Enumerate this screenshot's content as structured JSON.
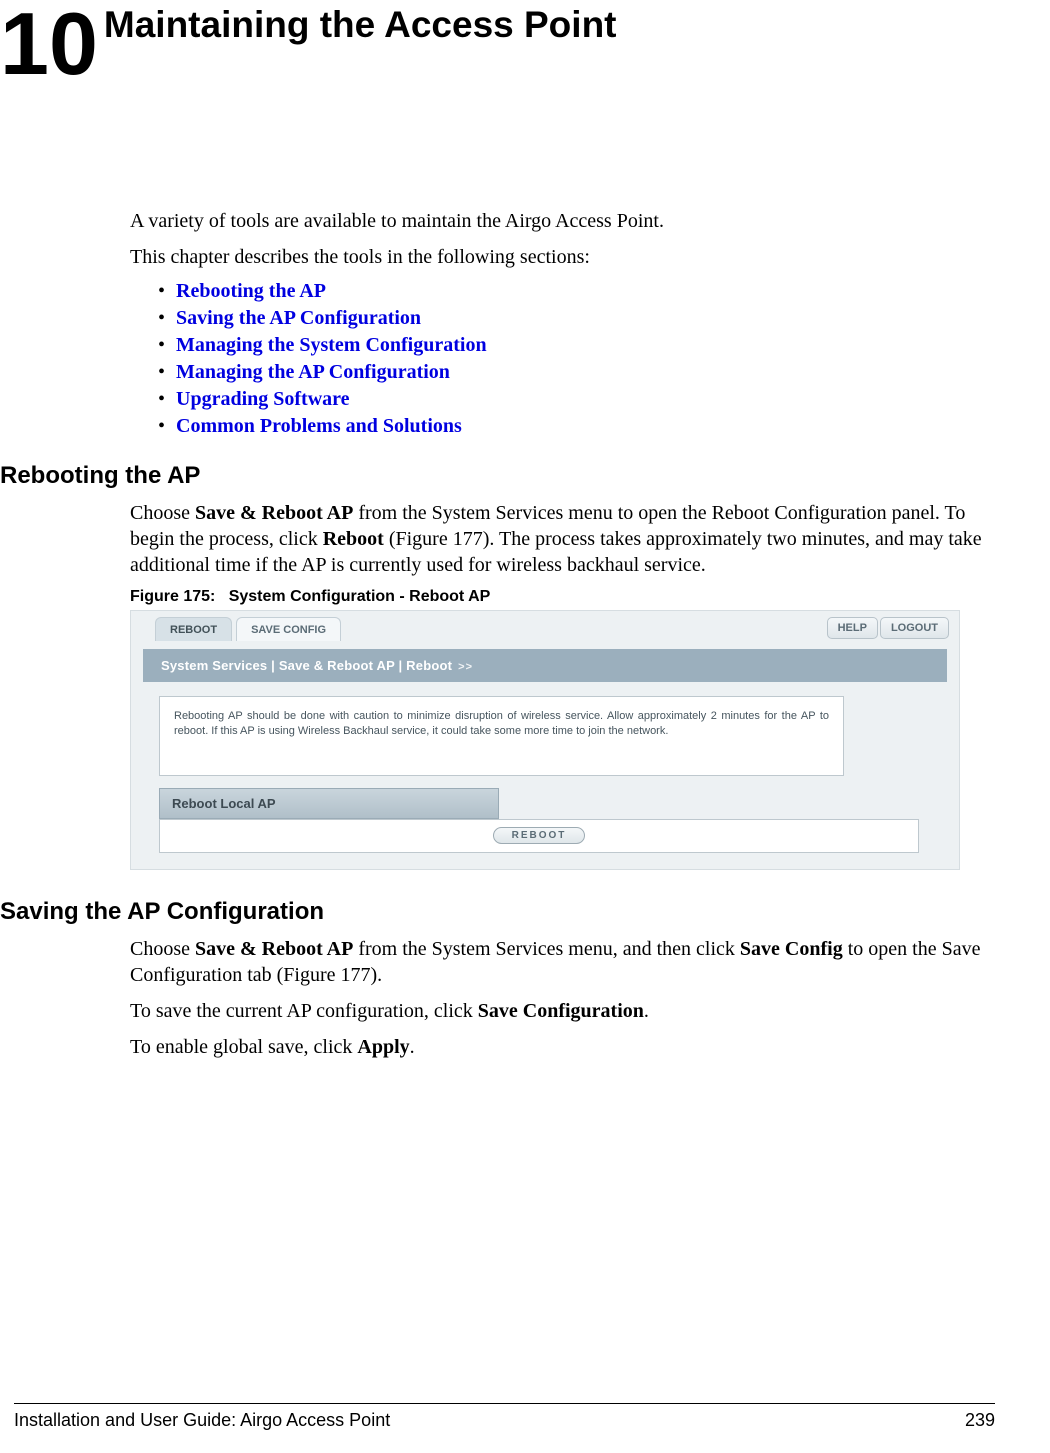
{
  "chapter": {
    "number": "10",
    "title": "Maintaining the Access Point"
  },
  "intro": {
    "p1": "A variety of tools are available to maintain the Airgo Access Point.",
    "p2": "This chapter describes the tools in the following sections:"
  },
  "toc": [
    "Rebooting the AP",
    "Saving the AP Configuration",
    "Managing the System Configuration",
    "Managing the AP Configuration",
    "Upgrading Software",
    "Common Problems and Solutions"
  ],
  "section1": {
    "heading": "Rebooting the AP",
    "p_parts": {
      "pre": "Choose ",
      "b1": "Save & Reboot AP",
      "mid1": " from the System Services menu to open the Reboot Configuration panel. To begin the process, click ",
      "b2": "Reboot",
      "mid2": " (Figure 177). The process takes approximately two minutes, and may take additional time if the AP is currently used for wireless backhaul service."
    },
    "fig_caption_label": "Figure 175:",
    "fig_caption_text": "System Configuration - Reboot AP"
  },
  "figure": {
    "tabs": {
      "reboot": "REBOOT",
      "save": "SAVE CONFIG"
    },
    "buttons": {
      "help": "HELP",
      "logout": "LOGOUT"
    },
    "breadcrumb": "System Services | Save & Reboot AP | Reboot",
    "breadcrumb_arrow": ">>",
    "info": "Rebooting AP should be done with caution to minimize disruption of wireless service. Allow approximately 2 minutes for the AP to reboot. If this AP is using Wireless Backhaul service, it could take some more time to join the network.",
    "section_bar": "Reboot Local AP",
    "reboot_button": "REBOOT"
  },
  "section2": {
    "heading": "Saving the AP Configuration",
    "p1_parts": {
      "pre": "Choose ",
      "b1": "Save & Reboot AP",
      "mid1": " from the System Services menu, and then click ",
      "b2": "Save Config",
      "mid2": " to open the Save Configuration tab (Figure 177)."
    },
    "p2_parts": {
      "pre": "To save the current AP configuration, click ",
      "b1": "Save Configuration",
      "post": "."
    },
    "p3_parts": {
      "pre": "To enable global save, click ",
      "b1": "Apply",
      "post": "."
    }
  },
  "footer": {
    "left": "Installation and User Guide: Airgo Access Point",
    "right": "239"
  }
}
